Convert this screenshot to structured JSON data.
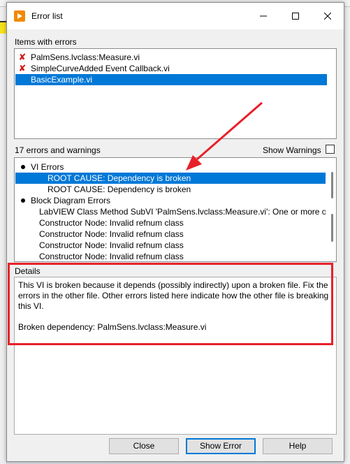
{
  "window": {
    "title": "Error list",
    "minimize_glyph": "—",
    "close_glyph": "✕"
  },
  "items_section": {
    "label": "Items with errors",
    "items": [
      {
        "text": "PalmSens.lvclass:Measure.vi",
        "has_error": true,
        "selected": false
      },
      {
        "text": "SimpleCurveAdded Event Callback.vi",
        "has_error": true,
        "selected": false
      },
      {
        "text": "BasicExample.vi",
        "has_error": false,
        "selected": true
      }
    ]
  },
  "errors_section": {
    "count_label": "17 errors and warnings",
    "show_warnings_label": "Show Warnings",
    "show_warnings_checked": false,
    "rows": [
      {
        "text": "VI Errors",
        "level": 0,
        "bullet": true,
        "selected": false
      },
      {
        "text": "ROOT CAUSE: Dependency is broken",
        "level": 2,
        "bullet": false,
        "selected": true
      },
      {
        "text": "ROOT CAUSE: Dependency is broken",
        "level": 2,
        "bullet": false,
        "selected": false
      },
      {
        "text": "Block Diagram Errors",
        "level": 0,
        "bullet": true,
        "selected": false
      },
      {
        "text": "LabVIEW Class Method SubVI 'PalmSens.lvclass:Measure.vi': One or more of the",
        "level": 1,
        "bullet": false,
        "selected": false
      },
      {
        "text": "Constructor Node: Invalid refnum class",
        "level": 1,
        "bullet": false,
        "selected": false
      },
      {
        "text": "Constructor Node: Invalid refnum class",
        "level": 1,
        "bullet": false,
        "selected": false
      },
      {
        "text": "Constructor Node: Invalid refnum class",
        "level": 1,
        "bullet": false,
        "selected": false
      },
      {
        "text": "Constructor Node: Invalid refnum class",
        "level": 1,
        "bullet": false,
        "selected": false
      }
    ]
  },
  "details": {
    "label": "Details",
    "text": "This VI is broken because it depends (possibly indirectly) upon a broken file. Fix the errors in the other file. Other errors listed here indicate how the other file is breaking this VI.\n\nBroken dependency: PalmSens.lvclass:Measure.vi"
  },
  "buttons": {
    "close": "Close",
    "show_error": "Show Error",
    "help": "Help"
  },
  "colors": {
    "selection": "#0078d7",
    "annotation_red": "#e8202a",
    "error_mark": "#d11616",
    "app_icon": "#f08a00"
  }
}
